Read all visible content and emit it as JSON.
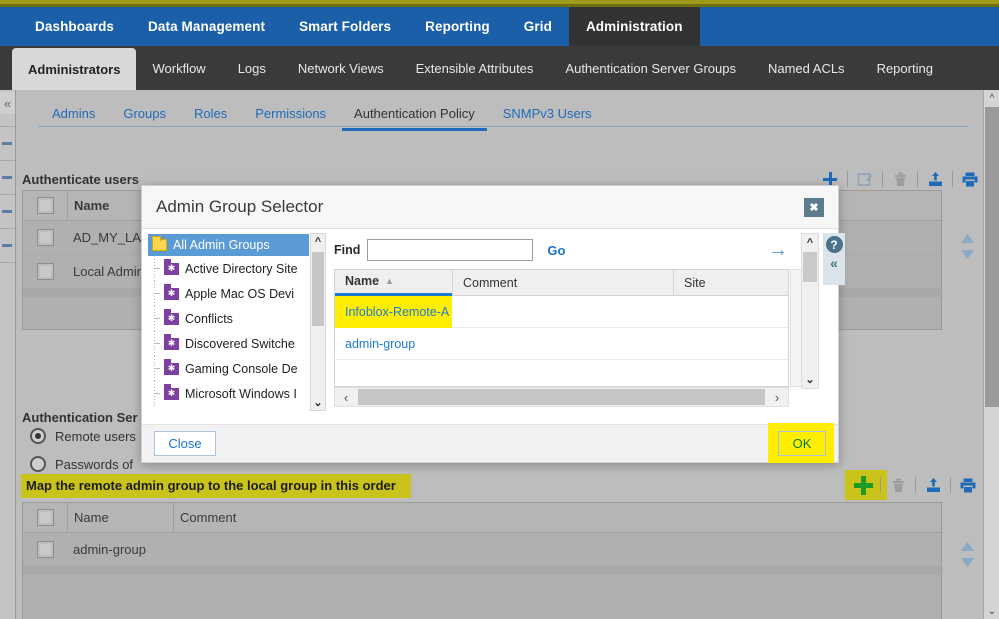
{
  "mainnav": {
    "items": [
      {
        "label": "Dashboards",
        "active": false
      },
      {
        "label": "Data Management",
        "active": false
      },
      {
        "label": "Smart Folders",
        "active": false
      },
      {
        "label": "Reporting",
        "active": false
      },
      {
        "label": "Grid",
        "active": false
      },
      {
        "label": "Administration",
        "active": true
      }
    ]
  },
  "subnav": {
    "items": [
      {
        "label": "Administrators",
        "active": true
      },
      {
        "label": "Workflow",
        "active": false
      },
      {
        "label": "Logs",
        "active": false
      },
      {
        "label": "Network Views",
        "active": false
      },
      {
        "label": "Extensible Attributes",
        "active": false
      },
      {
        "label": "Authentication Server Groups",
        "active": false
      },
      {
        "label": "Named ACLs",
        "active": false
      },
      {
        "label": "Reporting",
        "active": false
      }
    ]
  },
  "tabs3": {
    "items": [
      {
        "label": "Admins",
        "active": false
      },
      {
        "label": "Groups",
        "active": false
      },
      {
        "label": "Roles",
        "active": false
      },
      {
        "label": "Permissions",
        "active": false
      },
      {
        "label": "Authentication Policy",
        "active": true
      },
      {
        "label": "SNMPv3 Users",
        "active": false
      }
    ]
  },
  "authenticate_section": {
    "title": "Authenticate users",
    "columns": [
      "Name"
    ],
    "rows": [
      {
        "name": "AD_MY_LAB"
      },
      {
        "name": "Local Admin"
      }
    ],
    "toolbar": [
      "add-icon",
      "edit-icon",
      "delete-icon",
      "upload-icon",
      "print-icon"
    ]
  },
  "auth_service_section": {
    "title": "Authentication Ser",
    "options": [
      {
        "label": "Remote users",
        "selected": true
      },
      {
        "label": "Passwords of",
        "selected": false
      }
    ]
  },
  "map_section": {
    "highlighted_title": "Map the remote admin group to the local group in this order",
    "columns": [
      "Name",
      "Comment"
    ],
    "rows": [
      {
        "name": "admin-group",
        "comment": ""
      }
    ],
    "toolbar": [
      "add-icon",
      "delete-icon",
      "upload-icon",
      "print-icon"
    ]
  },
  "modal": {
    "title": "Admin Group Selector",
    "close_label": "✖",
    "tree": {
      "root": "All Admin Groups",
      "items": [
        "Active Directory Site",
        "Apple Mac OS Devi",
        "Conflicts",
        "Discovered Switche",
        "Gaming Console De",
        "Microsoft Windows I"
      ]
    },
    "find": {
      "label": "Find",
      "value": "",
      "placeholder": "",
      "go_label": "Go"
    },
    "table": {
      "columns": [
        "Name",
        "Comment",
        "Site"
      ],
      "sort_column": "Name",
      "sort_direction": "asc",
      "rows": [
        {
          "name": "Infoblox-Remote-A",
          "comment": "",
          "site": "",
          "highlighted": true
        },
        {
          "name": "admin-group",
          "comment": "",
          "site": "",
          "highlighted": false
        }
      ]
    },
    "help_icon": "?",
    "collapse_icon": "«",
    "buttons": {
      "close": "Close",
      "ok": "OK"
    }
  },
  "colors": {
    "nav_blue": "#1a5fa8",
    "subnav_dark": "#3a3a3a",
    "highlight_yellow": "#ffee00",
    "highlight_olive": "#c9c31c",
    "accent_link": "#1f6bb8",
    "folder_yellow": "#ffd64d",
    "group_purple": "#7d3fa0",
    "add_green": "#1d9b26"
  }
}
